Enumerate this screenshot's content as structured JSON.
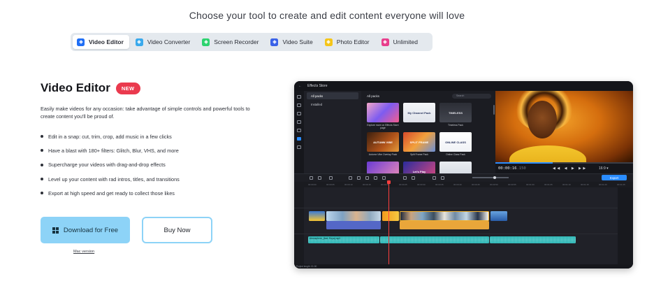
{
  "headline": "Choose your tool to create and edit content everyone will love",
  "tabs": [
    {
      "label": "Video Editor",
      "icon": "video-editor-icon",
      "color": "#1f6ef5",
      "active": true
    },
    {
      "label": "Video Converter",
      "icon": "video-converter-icon",
      "color": "#3aa9ec",
      "active": false
    },
    {
      "label": "Screen Recorder",
      "icon": "screen-recorder-icon",
      "color": "#2dd36f",
      "active": false
    },
    {
      "label": "Video Suite",
      "icon": "video-suite-icon",
      "color": "#3a62e8",
      "active": false
    },
    {
      "label": "Photo Editor",
      "icon": "photo-editor-icon",
      "color": "#f5c518",
      "active": false
    },
    {
      "label": "Unlimited",
      "icon": "unlimited-icon",
      "color": "#e83e8c",
      "active": false
    }
  ],
  "product": {
    "title": "Video Editor",
    "badge": "NEW",
    "description": "Easily make videos for any occasion: take advantage of simple controls and powerful tools to create content you'll be proud of.",
    "features": [
      "Edit in a snap: cut, trim, crop, add music in a few clicks",
      "Have a blast with 180+ filters: Glitch, Blur, VHS, and more",
      "Supercharge your videos with drag-and-drop effects",
      "Level up your content with rad intros, titles, and transitions",
      "Export at high speed and get ready to collect those likes"
    ],
    "download_label": "Download for Free",
    "buy_label": "Buy Now",
    "mac_label": "Mac version"
  },
  "app": {
    "window_title": "Effects Store",
    "categories": [
      {
        "label": "All packs",
        "active": true
      },
      {
        "label": "Installed",
        "active": false
      }
    ],
    "grid_title": "All packs",
    "search_placeholder": "Search",
    "packs": [
      {
        "name": "Explore more on Effects Store page",
        "thumb_text": ""
      },
      {
        "name": "",
        "thumb_text": "My Channel Pack"
      },
      {
        "name": "Timeless Pack",
        "thumb_text": "TIMELESS"
      },
      {
        "name": "Autumn Vibe Overlay Pack",
        "thumb_text": "AUTUMN VIBE"
      },
      {
        "name": "Split Frame Pack",
        "thumb_text": "SPLIT FRAME"
      },
      {
        "name": "Online Class Pack",
        "thumb_text": "ONLINE CLASS"
      },
      {
        "name": "",
        "thumb_text": ""
      },
      {
        "name": "",
        "thumb_text": "Let's Play"
      },
      {
        "name": "",
        "thumb_text": ""
      }
    ],
    "timecode": "00:00:16",
    "timecode_ms": ".150",
    "aspect_ratio": "16:9",
    "export_label": "Export",
    "ruler_ticks": [
      "00:00:00",
      "00:00:05",
      "00:00:10",
      "00:00:15",
      "00:00:20",
      "00:00:25",
      "00:00:30",
      "00:00:35",
      "00:00:40",
      "00:00:45",
      "00:00:50",
      "00:00:55",
      "00:01:00",
      "00:01:05",
      "00:01:10",
      "00:01:15",
      "00:01:20",
      "00:01:25"
    ],
    "audio_label": "Atmosphere_(feat. Roya).mp3",
    "project_length": "Project length: 01:00"
  }
}
